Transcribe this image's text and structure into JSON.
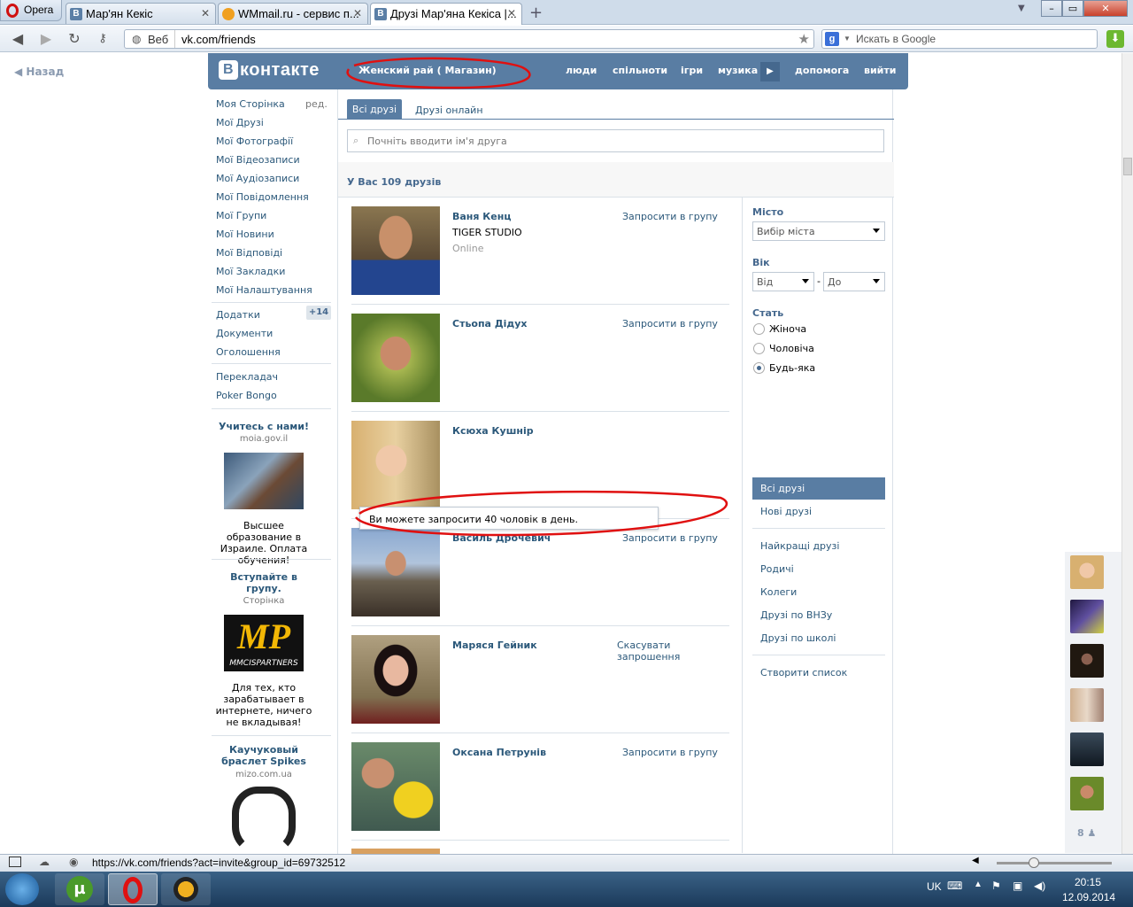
{
  "browser": {
    "opera_label": "Opera",
    "tabs": [
      {
        "label": "Мар'ян Кекіс",
        "icon": "vk-icon"
      },
      {
        "label": "WMmail.ru - сервис п...",
        "icon": "wmmail-icon"
      },
      {
        "label": "Друзі Мар'яна Кекіса |...",
        "icon": "vk-icon"
      }
    ],
    "web_label": "Веб",
    "url": "vk.com/friends",
    "search_placeholder": "Искать в Google"
  },
  "page": {
    "back_label": "Назад",
    "logo_text": "контакте",
    "logo_letter": "В",
    "header_title": "Женский рай ( Магазин)",
    "menu": [
      "люди",
      "спільноти",
      "ігри",
      "музика",
      "допомога",
      "вийти"
    ]
  },
  "sidebar": {
    "items": [
      "Моя Сторінка",
      "Мої Друзі",
      "Мої Фотографії",
      "Мої Відеозаписи",
      "Мої Аудіозаписи",
      "Мої Повідомлення",
      "Мої Групи",
      "Мої Новини",
      "Мої Відповіді",
      "Мої Закладки",
      "Мої Налаштування"
    ],
    "edit_label": "ред.",
    "extra": [
      "Додатки",
      "Документи",
      "Оголошення"
    ],
    "apps_count": "+14",
    "more": [
      "Перекладач",
      "Poker Bongo"
    ]
  },
  "ads": [
    {
      "title": "Учитесь с нами!",
      "domain": "moia.gov.il",
      "text": "Высшее образование в Израиле. Оплата обучения!"
    },
    {
      "title": "Вступайте в групу.",
      "domain": "Сторінка",
      "text": "Для тех, кто зарабатывает в интернете, ничего не вкладывая!",
      "logo_text": "MP",
      "logo_sub": "MMCISPARTNERS"
    },
    {
      "title": "Каучуковый браслет Spikes",
      "domain": "mizo.com.ua"
    }
  ],
  "friends_page": {
    "tab_all": "Всі друзі",
    "tab_online": "Друзі онлайн",
    "search_placeholder": "Почніть вводити ім'я друга",
    "count_text": "У Вас 109 друзів",
    "tooltip": "Ви можете запросити 40 чоловік в день.",
    "friends": [
      {
        "name": "Ваня Кенц",
        "sub": "TIGER STUDIO",
        "status": "Online",
        "action": "Запросити в групу"
      },
      {
        "name": "Стьопа Дідух",
        "action": "Запросити в групу"
      },
      {
        "name": "Ксюха Кушнір",
        "action": ""
      },
      {
        "name": "Василь Дрочевич",
        "action": "Запросити в групу"
      },
      {
        "name": "Маряся Гейник",
        "action": "Скасувати запрошення"
      },
      {
        "name": "Оксана Петрунів",
        "action": "Запросити в групу"
      }
    ]
  },
  "filters": {
    "city_label": "Місто",
    "city_value": "Вибір міста",
    "age_label": "Вік",
    "age_from": "Від",
    "age_to": "До",
    "age_dash": "-",
    "sex_label": "Стать",
    "sex_options": [
      "Жіноча",
      "Чоловіча",
      "Будь-яка"
    ],
    "sex_selected": "Будь-яка",
    "lists": [
      "Всі друзі",
      "Нові друзі"
    ],
    "lists2": [
      "Найкращі друзі",
      "Родичі",
      "Колеги",
      "Друзі по ВНЗу",
      "Друзі по школі"
    ],
    "create_list": "Створити список"
  },
  "dock": {
    "online_count": "8"
  },
  "statusbar": {
    "url": "https://vk.com/friends?act=invite&group_id=69732512"
  },
  "taskbar": {
    "lang": "UK",
    "time": "20:15",
    "date": "12.09.2014"
  },
  "colors": {
    "vk_blue": "#597da3",
    "link": "#2b587a",
    "annotation_red": "#e01010"
  }
}
